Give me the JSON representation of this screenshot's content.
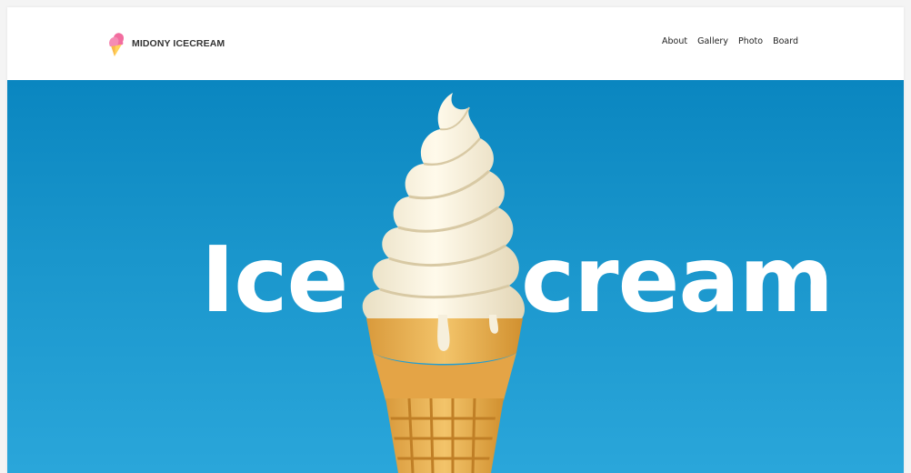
{
  "brand": {
    "name": "MIDONY ICECREAM",
    "logo_icon": "ice-cream-logo-icon",
    "logo_colors": [
      "#f26d9f",
      "#ffd35c"
    ]
  },
  "nav": {
    "items": [
      {
        "label": "About"
      },
      {
        "label": "Gallery"
      },
      {
        "label": "Photo"
      },
      {
        "label": "Board"
      }
    ]
  },
  "hero": {
    "word_left": "Ice",
    "word_right": "cream",
    "background_color": "#1a96cc",
    "text_color": "#ffffff"
  }
}
